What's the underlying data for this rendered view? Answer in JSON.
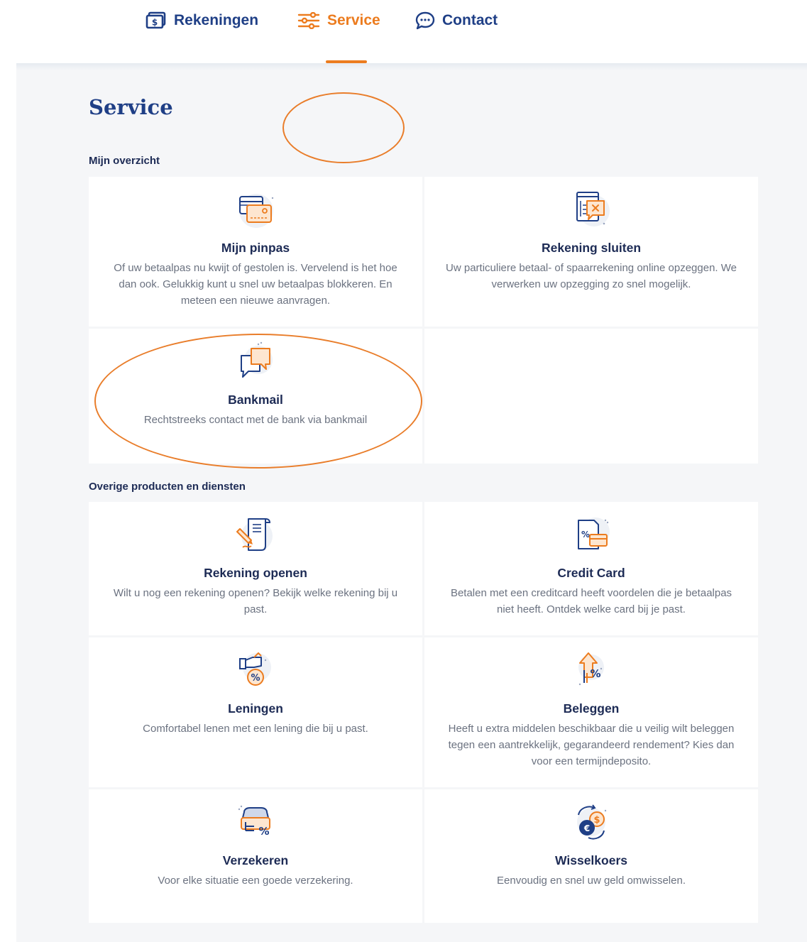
{
  "nav": {
    "items": [
      {
        "label": "Rekeningen",
        "icon": "accounts-icon"
      },
      {
        "label": "Service",
        "icon": "sliders-icon",
        "active": true
      },
      {
        "label": "Contact",
        "icon": "chat-bubble-icon"
      }
    ]
  },
  "page": {
    "title": "Service"
  },
  "sections": {
    "mijn_overzicht": {
      "title": "Mijn overzicht",
      "cards": [
        {
          "title": "Mijn pinpas",
          "description": "Of uw betaalpas nu kwijt of gestolen is. Vervelend is het hoe dan ook. Gelukkig kunt u snel uw betaalpas blokkeren. En meteen een nieuwe aanvragen.",
          "icon": "bank-card-icon"
        },
        {
          "title": "Rekening sluiten",
          "description": "Uw particuliere betaal- of spaarrekening online opzeggen. We verwerken uw opzegging zo snel mogelijk.",
          "icon": "close-account-icon"
        },
        {
          "title": "Bankmail",
          "description": "Rechtstreeks contact met de bank via bankmail",
          "icon": "speech-bubbles-icon"
        }
      ]
    },
    "overige": {
      "title": "Overige producten en diensten",
      "cards": [
        {
          "title": "Rekening openen",
          "description": "Wilt u nog een rekening openen? Bekijk welke rekening bij u past.",
          "icon": "document-sign-icon"
        },
        {
          "title": "Credit Card",
          "description": "Betalen met een creditcard heeft voordelen die je betaalpas niet heeft. Ontdek welke card bij je past.",
          "icon": "credit-card-percent-icon"
        },
        {
          "title": "Leningen",
          "description": "Comfortabel lenen met een lening die bij u past.",
          "icon": "loan-hand-icon"
        },
        {
          "title": "Beleggen",
          "description": "Heeft u extra middelen beschikbaar die u veilig wilt beleggen tegen een aantrekkelijk, gegarandeerd rendement? Kies dan voor een termijndeposito.",
          "icon": "invest-arrow-icon"
        },
        {
          "title": "Verzekeren",
          "description": "Voor elke situatie een goede verzekering.",
          "icon": "car-insurance-icon"
        },
        {
          "title": "Wisselkoers",
          "description": "Eenvoudig en snel uw geld omwisselen.",
          "icon": "currency-exchange-icon"
        }
      ]
    }
  },
  "colors": {
    "brand_blue": "#1f3f86",
    "accent_orange": "#ec7c1f",
    "background": "#f5f6f8",
    "annotation": "#e97d2a"
  }
}
